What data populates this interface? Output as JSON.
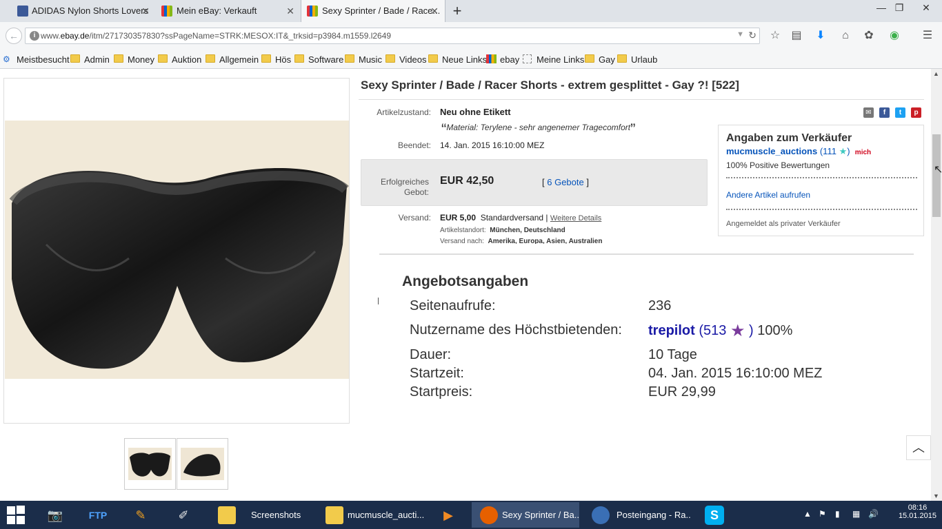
{
  "browser": {
    "tabs": [
      {
        "label": "ADIDAS Nylon Shorts Lovers"
      },
      {
        "label": "Mein eBay: Verkauft"
      },
      {
        "label": "Sexy Sprinter / Bade / Race..."
      }
    ],
    "url_prefix": "www.",
    "url_domain": "ebay.de",
    "url_path": "/itm/271730357830?ssPageName=STRK:MESOX:IT&_trksid=p3984.m1559.l2649",
    "bookmarks": [
      "Meistbesucht",
      "Admin",
      "Money",
      "Auktion",
      "Allgemein",
      "Hös",
      "Software",
      "Music",
      "Videos",
      "Neue Links",
      "ebay",
      "Meine Links",
      "Gay",
      "Urlaub"
    ]
  },
  "item": {
    "title": "Sexy Sprinter / Bade / Racer Shorts - extrem gesplittet - Gay ?! [522]",
    "condition_label": "Artikelzustand:",
    "condition_value": "Neu ohne Etikett",
    "condition_note": "Material: Terylene - sehr angenemer Tragecomfort",
    "ended_label": "Beendet:",
    "ended_value": "14. Jan. 2015  16:10:00 MEZ",
    "bid_label_1": "Erfolgreiches",
    "bid_label_2": "Gebot:",
    "price": "EUR 42,50",
    "bids_open": "[",
    "bids_link": "6 Gebote",
    "bids_close": "]",
    "shipping_label": "Versand:",
    "shipping_cost": "EUR 5,00",
    "shipping_method": "Standardversand |",
    "shipping_details": "Weitere Details",
    "location_label": "Artikelstandort:",
    "location_value": "München, Deutschland",
    "ships_to_label": "Versand nach:",
    "ships_to_value": "Amerika, Europa, Asien, Australien"
  },
  "seller": {
    "heading": "Angaben zum Verkäufer",
    "name": "mucmuscle_auctions",
    "feedback_open": "(111",
    "feedback_close": ")",
    "me_badge": "mich",
    "positive": "100% Positive Bewertungen",
    "other_items": "Andere Artikel aufrufen",
    "private": "Angemeldet als privater Verkäufer"
  },
  "offer": {
    "title": "Angebotsangaben",
    "views_label": "Seitenaufrufe:",
    "views_value": "236",
    "bidder_label": "Nutzername des Höchstbietenden:",
    "bidder_name": "trepilot",
    "bidder_feedback_open": "(513",
    "bidder_feedback_close": ")",
    "bidder_percent": "100%",
    "duration_label": "Dauer:",
    "duration_value": "10 Tage",
    "start_label": "Startzeit:",
    "start_value": "04. Jan. 2015 16:10:00 MEZ",
    "startprice_label": "Startpreis:",
    "startprice_value": "EUR 29,99"
  },
  "taskbar": {
    "items": [
      "Screenshots",
      "mucmuscle_aucti...",
      "Sexy Sprinter / Ba...",
      "Posteingang - Ra..."
    ],
    "ftp_badge": "FTP",
    "time": "08:16",
    "date": "15.01.2015"
  },
  "colors": {
    "ebay_link": "#0654ba",
    "taskbar": "#1b2d4a",
    "facebook": "#3b5998",
    "twitter": "#1da1f2",
    "pinterest": "#cb2027"
  }
}
